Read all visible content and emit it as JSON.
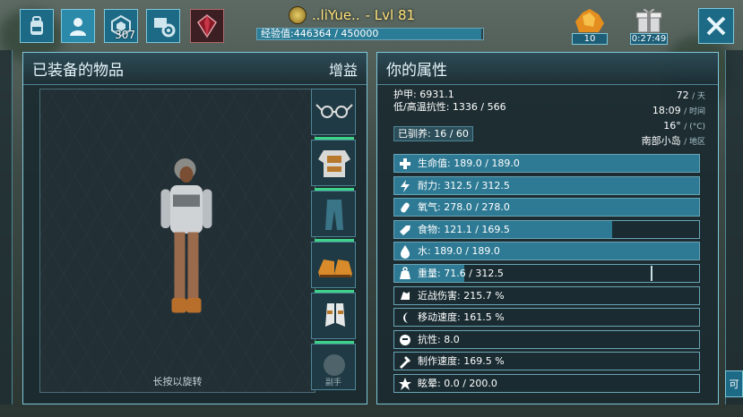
{
  "player": {
    "name": "..liYue..",
    "level_text": "- Lvl 81",
    "xp_text": "经验值:446364 / 450000",
    "xp_fraction": 0.992
  },
  "topbar": {
    "icons": [
      "inventory-backpack-icon",
      "character-icon",
      "tribe-icon",
      "crafting-icon",
      "crystal-icon"
    ],
    "tribe_count": "307"
  },
  "resources": {
    "element_count": "10",
    "gift_timer": "0:27:49"
  },
  "left_panel": {
    "title": "已装备的物品",
    "buff_label": "增益",
    "rotate_hint": "长按以旋转",
    "offhand_label": "副手",
    "slots": [
      {
        "icon": "glasses-icon",
        "durability": 1.0
      },
      {
        "icon": "chest-armor-icon",
        "durability": 1.0
      },
      {
        "icon": "leg-armor-icon",
        "durability": 1.0
      },
      {
        "icon": "boots-icon",
        "durability": 1.0
      },
      {
        "icon": "gloves-icon",
        "durability": 1.0
      },
      {
        "icon": "offhand-icon",
        "durability": 0.0
      }
    ]
  },
  "right_panel": {
    "title": "你的属性",
    "armor": "护甲: 6931.1",
    "temp_resist": "低/高温抗性: 1336 / 566",
    "tamed": "已驯养: 16 / 60",
    "world": {
      "day": "72",
      "day_unit": "/ 天",
      "time": "18:09",
      "time_unit": "/ 时间",
      "temp": "16°",
      "temp_unit": "/ (°C)",
      "region": "南部小岛",
      "region_unit": "/ 地区"
    },
    "stats": [
      {
        "icon": "health-icon",
        "text": "生命值: 189.0 / 189.0",
        "fraction": 1.0
      },
      {
        "icon": "stamina-icon",
        "text": "耐力: 312.5 / 312.5",
        "fraction": 1.0
      },
      {
        "icon": "oxygen-icon",
        "text": "氧气: 278.0 / 278.0",
        "fraction": 1.0
      },
      {
        "icon": "food-icon",
        "text": "食物: 121.1 / 169.5",
        "fraction": 0.714
      },
      {
        "icon": "water-icon",
        "text": "水: 189.0 / 189.0",
        "fraction": 1.0
      },
      {
        "icon": "weight-icon",
        "text": "重量: 71.6 / 312.5",
        "fraction": 0.229
      },
      {
        "icon": "melee-icon",
        "text": "近战伤害: 215.7 %",
        "fraction": 0
      },
      {
        "icon": "speed-icon",
        "text": "移动速度: 161.5 %",
        "fraction": 0
      },
      {
        "icon": "fortitude-icon",
        "text": "抗性: 8.0",
        "fraction": 0
      },
      {
        "icon": "crafting-speed-icon",
        "text": "制作速度: 169.5 %",
        "fraction": 0
      },
      {
        "icon": "torpor-icon",
        "text": "眩晕: 0.0 / 200.0",
        "fraction": 0
      }
    ]
  },
  "side_tab_label": "可",
  "colors": {
    "accent": "#7fc7da",
    "fill": "#2e7a94",
    "durability": "#3ed28a",
    "name": "#ffe27a"
  }
}
